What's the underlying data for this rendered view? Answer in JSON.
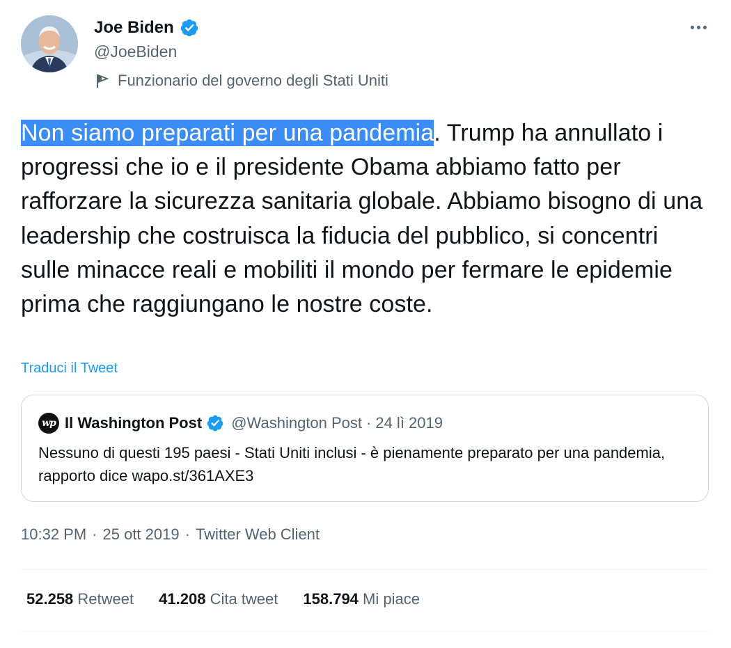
{
  "author": {
    "display_name": "Joe Biden",
    "handle": "@JoeBiden",
    "label": "Funzionario del governo degli Stati Uniti",
    "verified_icon": "verified-badge-icon",
    "label_icon": "flag-icon"
  },
  "more_icon": "more-options-icon",
  "tweet": {
    "text_highlighted": "Non siamo preparati per una pandemia",
    "text_rest": ". Trump ha annullato i progressi che io e il presidente Obama abbiamo fatto per rafforzare la sicurezza sanitaria globale. Abbiamo bisogno di una leadership che costruisca la fiducia del pubblico, si concentri sulle minacce reali e mobiliti il mondo per fermare le epidemie prima che raggiungano le nostre coste.",
    "translate_label": "Traduci il Tweet"
  },
  "quote": {
    "logo_text": "wp",
    "name": "Il Washington Post",
    "handle": "@Washington Post",
    "separator": "·",
    "date": "24 lì 2019",
    "text": "Nessuno di questi 195 paesi - Stati Uniti inclusi - è pienamente preparato per una pandemia, rapporto dice  wapo.st/361AXE3"
  },
  "meta": {
    "time": "10:32 PM",
    "separator": "·",
    "date": "25 ott 2019",
    "client": "Twitter Web Client"
  },
  "stats": [
    {
      "value": "52.258",
      "label": "Retweet"
    },
    {
      "value": "41.208",
      "label": "Cita tweet"
    },
    {
      "value": "158.794",
      "label": "Mi piace"
    }
  ],
  "colors": {
    "accent": "#1d9bf0",
    "selection": "#3b8cf4",
    "secondary_text": "#536471",
    "primary_text": "#0f1419",
    "border": "#cfd9de"
  }
}
